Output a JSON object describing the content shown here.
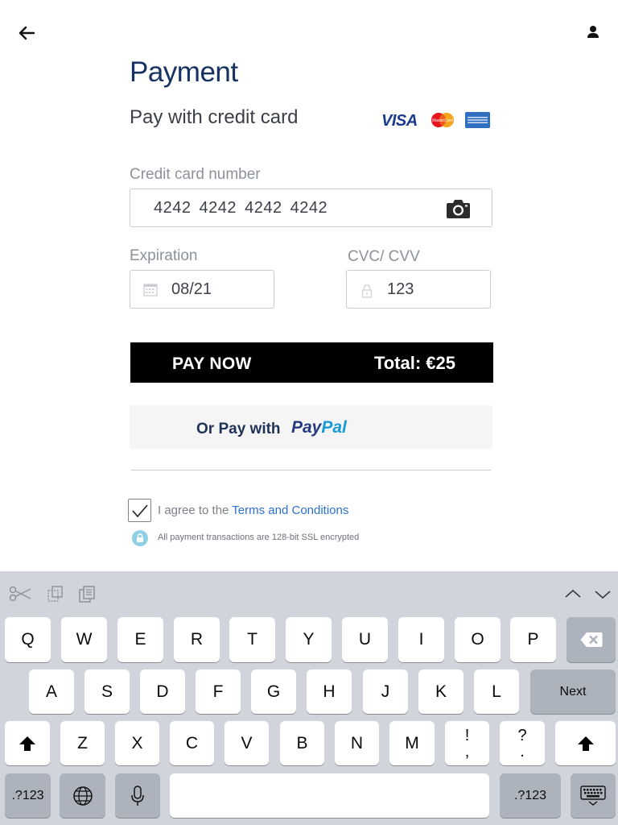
{
  "header": {
    "title": "Payment",
    "subtitle": "Pay with credit card",
    "card_brands": {
      "visa": "VISA",
      "mastercard": "MasterCard",
      "amex": "AMERICAN EXPRESS"
    }
  },
  "form": {
    "card_number": {
      "label": "Credit card number",
      "value": "4242  4242  4242  4242"
    },
    "expiration": {
      "label": "Expiration",
      "value": "08/21"
    },
    "cvc": {
      "label": "CVC/ CVV",
      "value": "123"
    }
  },
  "pay_button": {
    "label": "PAY NOW",
    "total": "Total: €25"
  },
  "paypal_button": {
    "label": "Or Pay with",
    "logo_pay": "Pay",
    "logo_pal": "Pal"
  },
  "agreement": {
    "checked": true,
    "text": "I agree to the ",
    "link": "Terms and Conditions",
    "ssl_note": "All payment transactions are 128-bit SSL encrypted"
  },
  "colors": {
    "title": "#163260",
    "link": "#2a6fd1",
    "pay_button_bg": "#000000",
    "keyboard_bg": "#d1d4db"
  },
  "keyboard": {
    "row1": [
      "Q",
      "W",
      "E",
      "R",
      "T",
      "Y",
      "U",
      "I",
      "O",
      "P"
    ],
    "row2": [
      "A",
      "S",
      "D",
      "F",
      "G",
      "H",
      "J",
      "K",
      "L"
    ],
    "row3": [
      "Z",
      "X",
      "C",
      "V",
      "B",
      "N",
      "M"
    ],
    "punct1": {
      "top": "!",
      "bottom": ","
    },
    "punct2": {
      "top": "?",
      "bottom": "."
    },
    "next_label": "Next",
    "numbers_label": ".?123"
  }
}
